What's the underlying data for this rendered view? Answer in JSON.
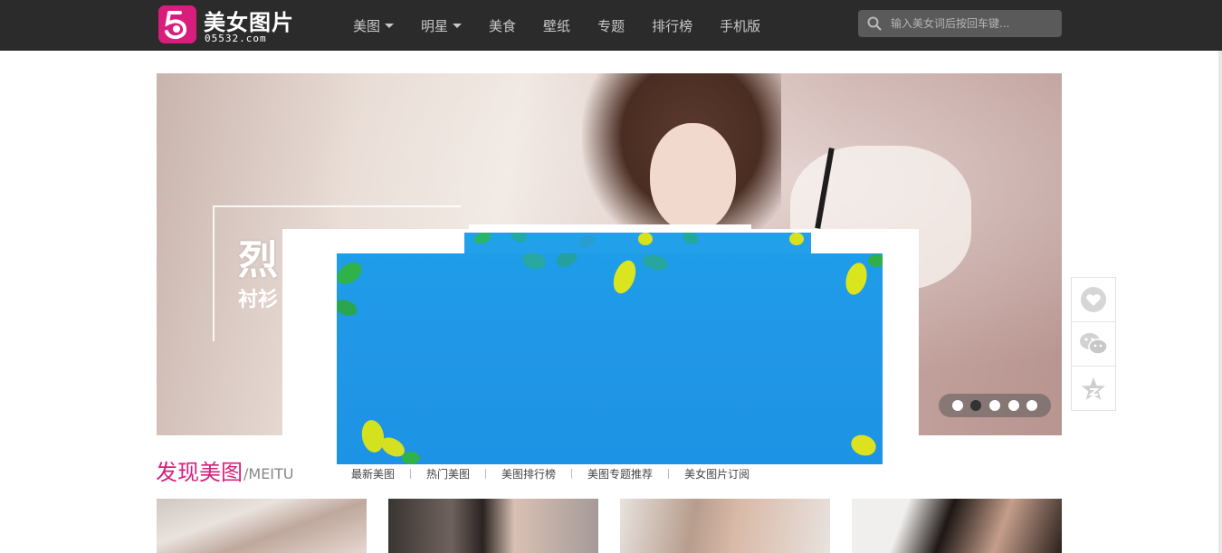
{
  "header": {
    "logo": {
      "name": "美女图片",
      "domain": "05532.com"
    },
    "nav": [
      {
        "label": "美图",
        "has_dropdown": true
      },
      {
        "label": "明星",
        "has_dropdown": true
      },
      {
        "label": "美食",
        "has_dropdown": false
      },
      {
        "label": "壁纸",
        "has_dropdown": false
      },
      {
        "label": "专题",
        "has_dropdown": false
      },
      {
        "label": "排行榜",
        "has_dropdown": false
      },
      {
        "label": "手机版",
        "has_dropdown": false
      }
    ],
    "search": {
      "placeholder": "输入美女词后按回车键..."
    }
  },
  "banner": {
    "title": "烈",
    "subtitle": "衬衫",
    "slide_count": 5,
    "active_slide": 2
  },
  "side_tools": {
    "icons": [
      "heart-icon",
      "wechat-icon",
      "star-icon"
    ]
  },
  "section": {
    "title": "发现美图",
    "subtitle": "/MEITU",
    "tabs": [
      "最新美图",
      "热门美图",
      "美图排行榜",
      "美图专题推荐",
      "美女图片订阅"
    ]
  },
  "thumbnails": {
    "count": 4
  },
  "colors": {
    "topbar": "#2b2b2b",
    "brand": "#d81e7d",
    "popup_blue": "#1e9de9",
    "leaf_green": "#2fbf6a",
    "leaf_yellow": "#d8e21c"
  }
}
